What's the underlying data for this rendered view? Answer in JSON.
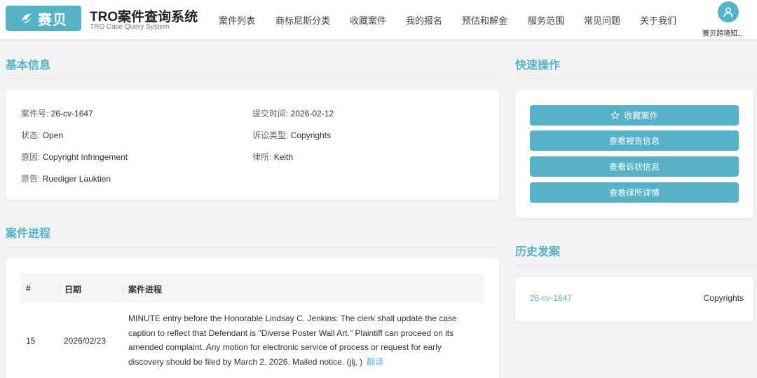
{
  "brand": {
    "logo_text": "赛贝",
    "title": "TRO案件查询系统",
    "subtitle": "TRO Case Query System"
  },
  "nav": {
    "items": [
      {
        "label": "案件列表"
      },
      {
        "label": "商标尼斯分类"
      },
      {
        "label": "收藏案件"
      },
      {
        "label": "我的报名"
      },
      {
        "label": "预估和解金"
      },
      {
        "label": "服务范围"
      },
      {
        "label": "常见问题"
      },
      {
        "label": "关于我们"
      }
    ]
  },
  "user": {
    "name": "赛贝跨境知..."
  },
  "basic_info": {
    "heading": "基本信息",
    "case_no_label": "案件号:",
    "case_no": "26-cv-1647",
    "filed_label": "提交时间:",
    "filed": "2026-02-12",
    "status_label": "状态:",
    "status": "Open",
    "type_label": "诉讼类型:",
    "type": "Copyrights",
    "cause_label": "原因:",
    "cause": "Copyright Infringement",
    "firm_label": "律所:",
    "firm": "Keith",
    "plaintiff_label": "原告:",
    "plaintiff": "Ruediger Lauktien"
  },
  "quick_actions": {
    "heading": "快速操作",
    "buttons": [
      {
        "label": "收藏案件",
        "icon": "star-icon"
      },
      {
        "label": "查看被告信息"
      },
      {
        "label": "查看诉状信息"
      },
      {
        "label": "查看律所详情"
      }
    ]
  },
  "history": {
    "heading": "历史发案",
    "items": [
      {
        "case_no": "26-cv-1647",
        "type": "Copyrights"
      }
    ]
  },
  "progress": {
    "heading": "案件进程",
    "columns": [
      "#",
      "日期",
      "案件进程"
    ],
    "rows": [
      {
        "num": "15",
        "date": "2026/02/23",
        "text": "MINUTE entry before the Honorable Lindsay C. Jenkins: The clerk shall update the case caption to reflect that Defendant is \"Diverse Poster Wall Art.\" Plaintiff can proceed on its amended complaint. Any motion for electronic service of process or request for early discovery should be filed by March 2, 2026. Mailed notice. (jlj, )",
        "translate_label": "翻译"
      }
    ]
  },
  "colors": {
    "accent": "#56b2c9",
    "background": "#f2f3f5",
    "card": "#ffffff"
  }
}
